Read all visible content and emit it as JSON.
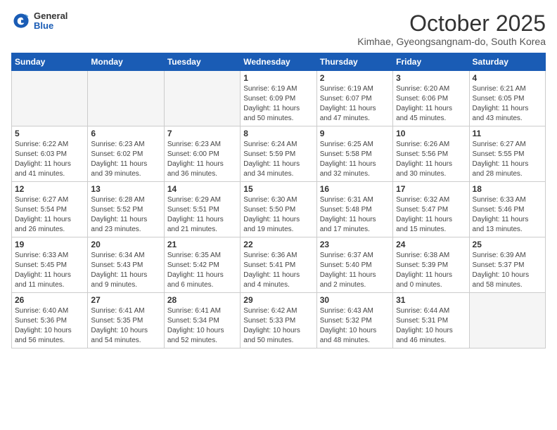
{
  "logo": {
    "general": "General",
    "blue": "Blue"
  },
  "title": {
    "month": "October 2025",
    "location": "Kimhae, Gyeongsangnam-do, South Korea"
  },
  "weekdays": [
    "Sunday",
    "Monday",
    "Tuesday",
    "Wednesday",
    "Thursday",
    "Friday",
    "Saturday"
  ],
  "weeks": [
    [
      {
        "day": "",
        "info": ""
      },
      {
        "day": "",
        "info": ""
      },
      {
        "day": "",
        "info": ""
      },
      {
        "day": "1",
        "info": "Sunrise: 6:19 AM\nSunset: 6:09 PM\nDaylight: 11 hours\nand 50 minutes."
      },
      {
        "day": "2",
        "info": "Sunrise: 6:19 AM\nSunset: 6:07 PM\nDaylight: 11 hours\nand 47 minutes."
      },
      {
        "day": "3",
        "info": "Sunrise: 6:20 AM\nSunset: 6:06 PM\nDaylight: 11 hours\nand 45 minutes."
      },
      {
        "day": "4",
        "info": "Sunrise: 6:21 AM\nSunset: 6:05 PM\nDaylight: 11 hours\nand 43 minutes."
      }
    ],
    [
      {
        "day": "5",
        "info": "Sunrise: 6:22 AM\nSunset: 6:03 PM\nDaylight: 11 hours\nand 41 minutes."
      },
      {
        "day": "6",
        "info": "Sunrise: 6:23 AM\nSunset: 6:02 PM\nDaylight: 11 hours\nand 39 minutes."
      },
      {
        "day": "7",
        "info": "Sunrise: 6:23 AM\nSunset: 6:00 PM\nDaylight: 11 hours\nand 36 minutes."
      },
      {
        "day": "8",
        "info": "Sunrise: 6:24 AM\nSunset: 5:59 PM\nDaylight: 11 hours\nand 34 minutes."
      },
      {
        "day": "9",
        "info": "Sunrise: 6:25 AM\nSunset: 5:58 PM\nDaylight: 11 hours\nand 32 minutes."
      },
      {
        "day": "10",
        "info": "Sunrise: 6:26 AM\nSunset: 5:56 PM\nDaylight: 11 hours\nand 30 minutes."
      },
      {
        "day": "11",
        "info": "Sunrise: 6:27 AM\nSunset: 5:55 PM\nDaylight: 11 hours\nand 28 minutes."
      }
    ],
    [
      {
        "day": "12",
        "info": "Sunrise: 6:27 AM\nSunset: 5:54 PM\nDaylight: 11 hours\nand 26 minutes."
      },
      {
        "day": "13",
        "info": "Sunrise: 6:28 AM\nSunset: 5:52 PM\nDaylight: 11 hours\nand 23 minutes."
      },
      {
        "day": "14",
        "info": "Sunrise: 6:29 AM\nSunset: 5:51 PM\nDaylight: 11 hours\nand 21 minutes."
      },
      {
        "day": "15",
        "info": "Sunrise: 6:30 AM\nSunset: 5:50 PM\nDaylight: 11 hours\nand 19 minutes."
      },
      {
        "day": "16",
        "info": "Sunrise: 6:31 AM\nSunset: 5:48 PM\nDaylight: 11 hours\nand 17 minutes."
      },
      {
        "day": "17",
        "info": "Sunrise: 6:32 AM\nSunset: 5:47 PM\nDaylight: 11 hours\nand 15 minutes."
      },
      {
        "day": "18",
        "info": "Sunrise: 6:33 AM\nSunset: 5:46 PM\nDaylight: 11 hours\nand 13 minutes."
      }
    ],
    [
      {
        "day": "19",
        "info": "Sunrise: 6:33 AM\nSunset: 5:45 PM\nDaylight: 11 hours\nand 11 minutes."
      },
      {
        "day": "20",
        "info": "Sunrise: 6:34 AM\nSunset: 5:43 PM\nDaylight: 11 hours\nand 9 minutes."
      },
      {
        "day": "21",
        "info": "Sunrise: 6:35 AM\nSunset: 5:42 PM\nDaylight: 11 hours\nand 6 minutes."
      },
      {
        "day": "22",
        "info": "Sunrise: 6:36 AM\nSunset: 5:41 PM\nDaylight: 11 hours\nand 4 minutes."
      },
      {
        "day": "23",
        "info": "Sunrise: 6:37 AM\nSunset: 5:40 PM\nDaylight: 11 hours\nand 2 minutes."
      },
      {
        "day": "24",
        "info": "Sunrise: 6:38 AM\nSunset: 5:39 PM\nDaylight: 11 hours\nand 0 minutes."
      },
      {
        "day": "25",
        "info": "Sunrise: 6:39 AM\nSunset: 5:37 PM\nDaylight: 10 hours\nand 58 minutes."
      }
    ],
    [
      {
        "day": "26",
        "info": "Sunrise: 6:40 AM\nSunset: 5:36 PM\nDaylight: 10 hours\nand 56 minutes."
      },
      {
        "day": "27",
        "info": "Sunrise: 6:41 AM\nSunset: 5:35 PM\nDaylight: 10 hours\nand 54 minutes."
      },
      {
        "day": "28",
        "info": "Sunrise: 6:41 AM\nSunset: 5:34 PM\nDaylight: 10 hours\nand 52 minutes."
      },
      {
        "day": "29",
        "info": "Sunrise: 6:42 AM\nSunset: 5:33 PM\nDaylight: 10 hours\nand 50 minutes."
      },
      {
        "day": "30",
        "info": "Sunrise: 6:43 AM\nSunset: 5:32 PM\nDaylight: 10 hours\nand 48 minutes."
      },
      {
        "day": "31",
        "info": "Sunrise: 6:44 AM\nSunset: 5:31 PM\nDaylight: 10 hours\nand 46 minutes."
      },
      {
        "day": "",
        "info": ""
      }
    ]
  ]
}
